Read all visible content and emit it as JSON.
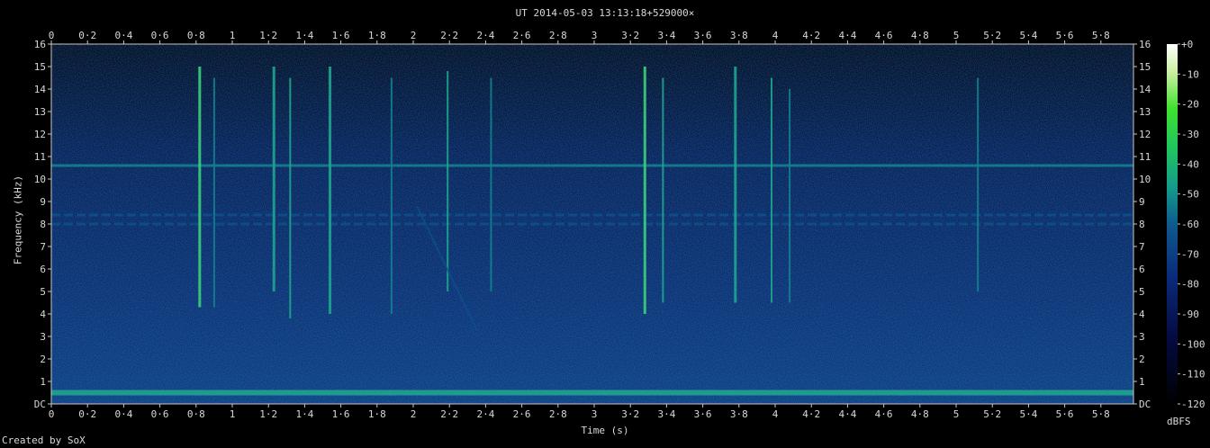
{
  "chart_data": {
    "type": "heatmap",
    "title": "UT 2014-05-03 13:13:18+529000×",
    "xlabel": "Time (s)",
    "ylabel": "Frequency (kHz)",
    "xlim": [
      0,
      5.98
    ],
    "ylim": [
      0,
      16
    ],
    "x_ticks": [
      "0",
      "0·2",
      "0·4",
      "0·6",
      "0·8",
      "1",
      "1·2",
      "1·4",
      "1·6",
      "1·8",
      "2",
      "2·2",
      "2·4",
      "2·6",
      "2·8",
      "3",
      "3·2",
      "3·4",
      "3·6",
      "3·8",
      "4",
      "4·2",
      "4·4",
      "4·6",
      "4·8",
      "5",
      "5·2",
      "5·4",
      "5·6",
      "5·8"
    ],
    "y_ticks": [
      "DC",
      "1",
      "2",
      "3",
      "4",
      "5",
      "6",
      "7",
      "8",
      "9",
      "10",
      "11",
      "12",
      "13",
      "14",
      "15",
      "16"
    ],
    "colorbar": {
      "label": "dBFS",
      "ticks": [
        "+0",
        "-10",
        "-20",
        "-30",
        "-40",
        "-50",
        "-60",
        "-70",
        "-80",
        "-90",
        "-100",
        "-110",
        "-120"
      ],
      "range": [
        -120,
        0
      ]
    },
    "background_level_dbfs": -95,
    "persistent_tones_khz": [
      {
        "freq": 10.6,
        "level_dbfs": -75
      },
      {
        "freq": 8.4,
        "level_dbfs": -85
      },
      {
        "freq": 8.0,
        "level_dbfs": -85
      },
      {
        "freq": 0.5,
        "level_dbfs": -70
      }
    ],
    "bursts": [
      {
        "time": 0.82,
        "fmin": 4.3,
        "fmax": 15.0,
        "level_dbfs": -60
      },
      {
        "time": 0.9,
        "fmin": 4.3,
        "fmax": 14.5,
        "level_dbfs": -75
      },
      {
        "time": 1.23,
        "fmin": 5.0,
        "fmax": 15.0,
        "level_dbfs": -65
      },
      {
        "time": 1.32,
        "fmin": 3.8,
        "fmax": 14.5,
        "level_dbfs": -70
      },
      {
        "time": 1.54,
        "fmin": 4.0,
        "fmax": 15.0,
        "level_dbfs": -65
      },
      {
        "time": 1.88,
        "fmin": 4.0,
        "fmax": 14.5,
        "level_dbfs": -80
      },
      {
        "time": 2.19,
        "fmin": 5.0,
        "fmax": 14.8,
        "level_dbfs": -70
      },
      {
        "time": 2.43,
        "fmin": 5.0,
        "fmax": 14.5,
        "level_dbfs": -75
      },
      {
        "time": 3.28,
        "fmin": 4.0,
        "fmax": 15.0,
        "level_dbfs": -60
      },
      {
        "time": 3.38,
        "fmin": 4.5,
        "fmax": 14.5,
        "level_dbfs": -70
      },
      {
        "time": 3.78,
        "fmin": 4.5,
        "fmax": 15.0,
        "level_dbfs": -65
      },
      {
        "time": 3.98,
        "fmin": 4.5,
        "fmax": 14.5,
        "level_dbfs": -70
      },
      {
        "time": 4.08,
        "fmin": 4.5,
        "fmax": 14.0,
        "level_dbfs": -80
      },
      {
        "time": 5.12,
        "fmin": 5.0,
        "fmax": 14.5,
        "level_dbfs": -75
      }
    ],
    "sweep": {
      "t_start": 2.02,
      "f_start": 8.8,
      "t_end": 2.35,
      "f_end": 3.3,
      "level_dbfs": -85
    }
  },
  "credit": "Created by SoX",
  "colors": {
    "background": "#000000",
    "noise_floor": "#0a2a6e",
    "tone": "#1a9a8a",
    "strong": "#3ccf6a",
    "text": "#d8d8d8"
  }
}
